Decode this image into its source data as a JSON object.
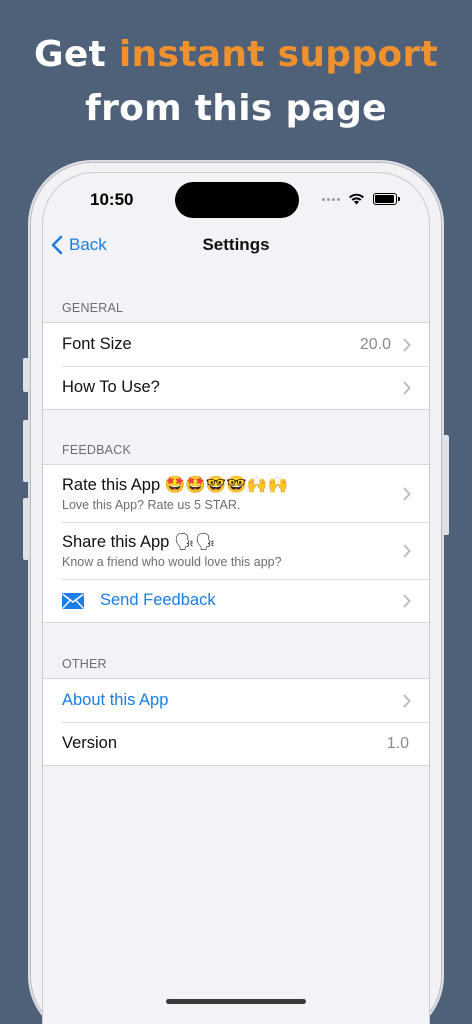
{
  "headline": {
    "line1_prefix": "Get ",
    "line1_accent": "instant support",
    "line2": "from this page"
  },
  "status_bar": {
    "time": "10:50"
  },
  "nav": {
    "back_label": "Back",
    "title": "Settings"
  },
  "sections": {
    "general": {
      "header": "GENERAL",
      "font_size": {
        "label": "Font Size",
        "value": "20.0"
      },
      "how_to_use": {
        "label": "How To Use?"
      }
    },
    "feedback": {
      "header": "FEEDBACK",
      "rate": {
        "label": "Rate this App 🤩🤩🤓🤓🙌🙌",
        "subtitle": "Love this App? Rate us 5 STAR."
      },
      "share": {
        "label": "Share this App 🗣🗣",
        "subtitle": "Know a friend who would love this app?"
      },
      "send_feedback": {
        "label": "Send Feedback"
      }
    },
    "other": {
      "header": "OTHER",
      "about": {
        "label": "About this App"
      },
      "version": {
        "label": "Version",
        "value": "1.0"
      }
    }
  },
  "colors": {
    "background": "#4f6079",
    "accent": "#f0912f",
    "link_blue": "#1a7ee6"
  }
}
